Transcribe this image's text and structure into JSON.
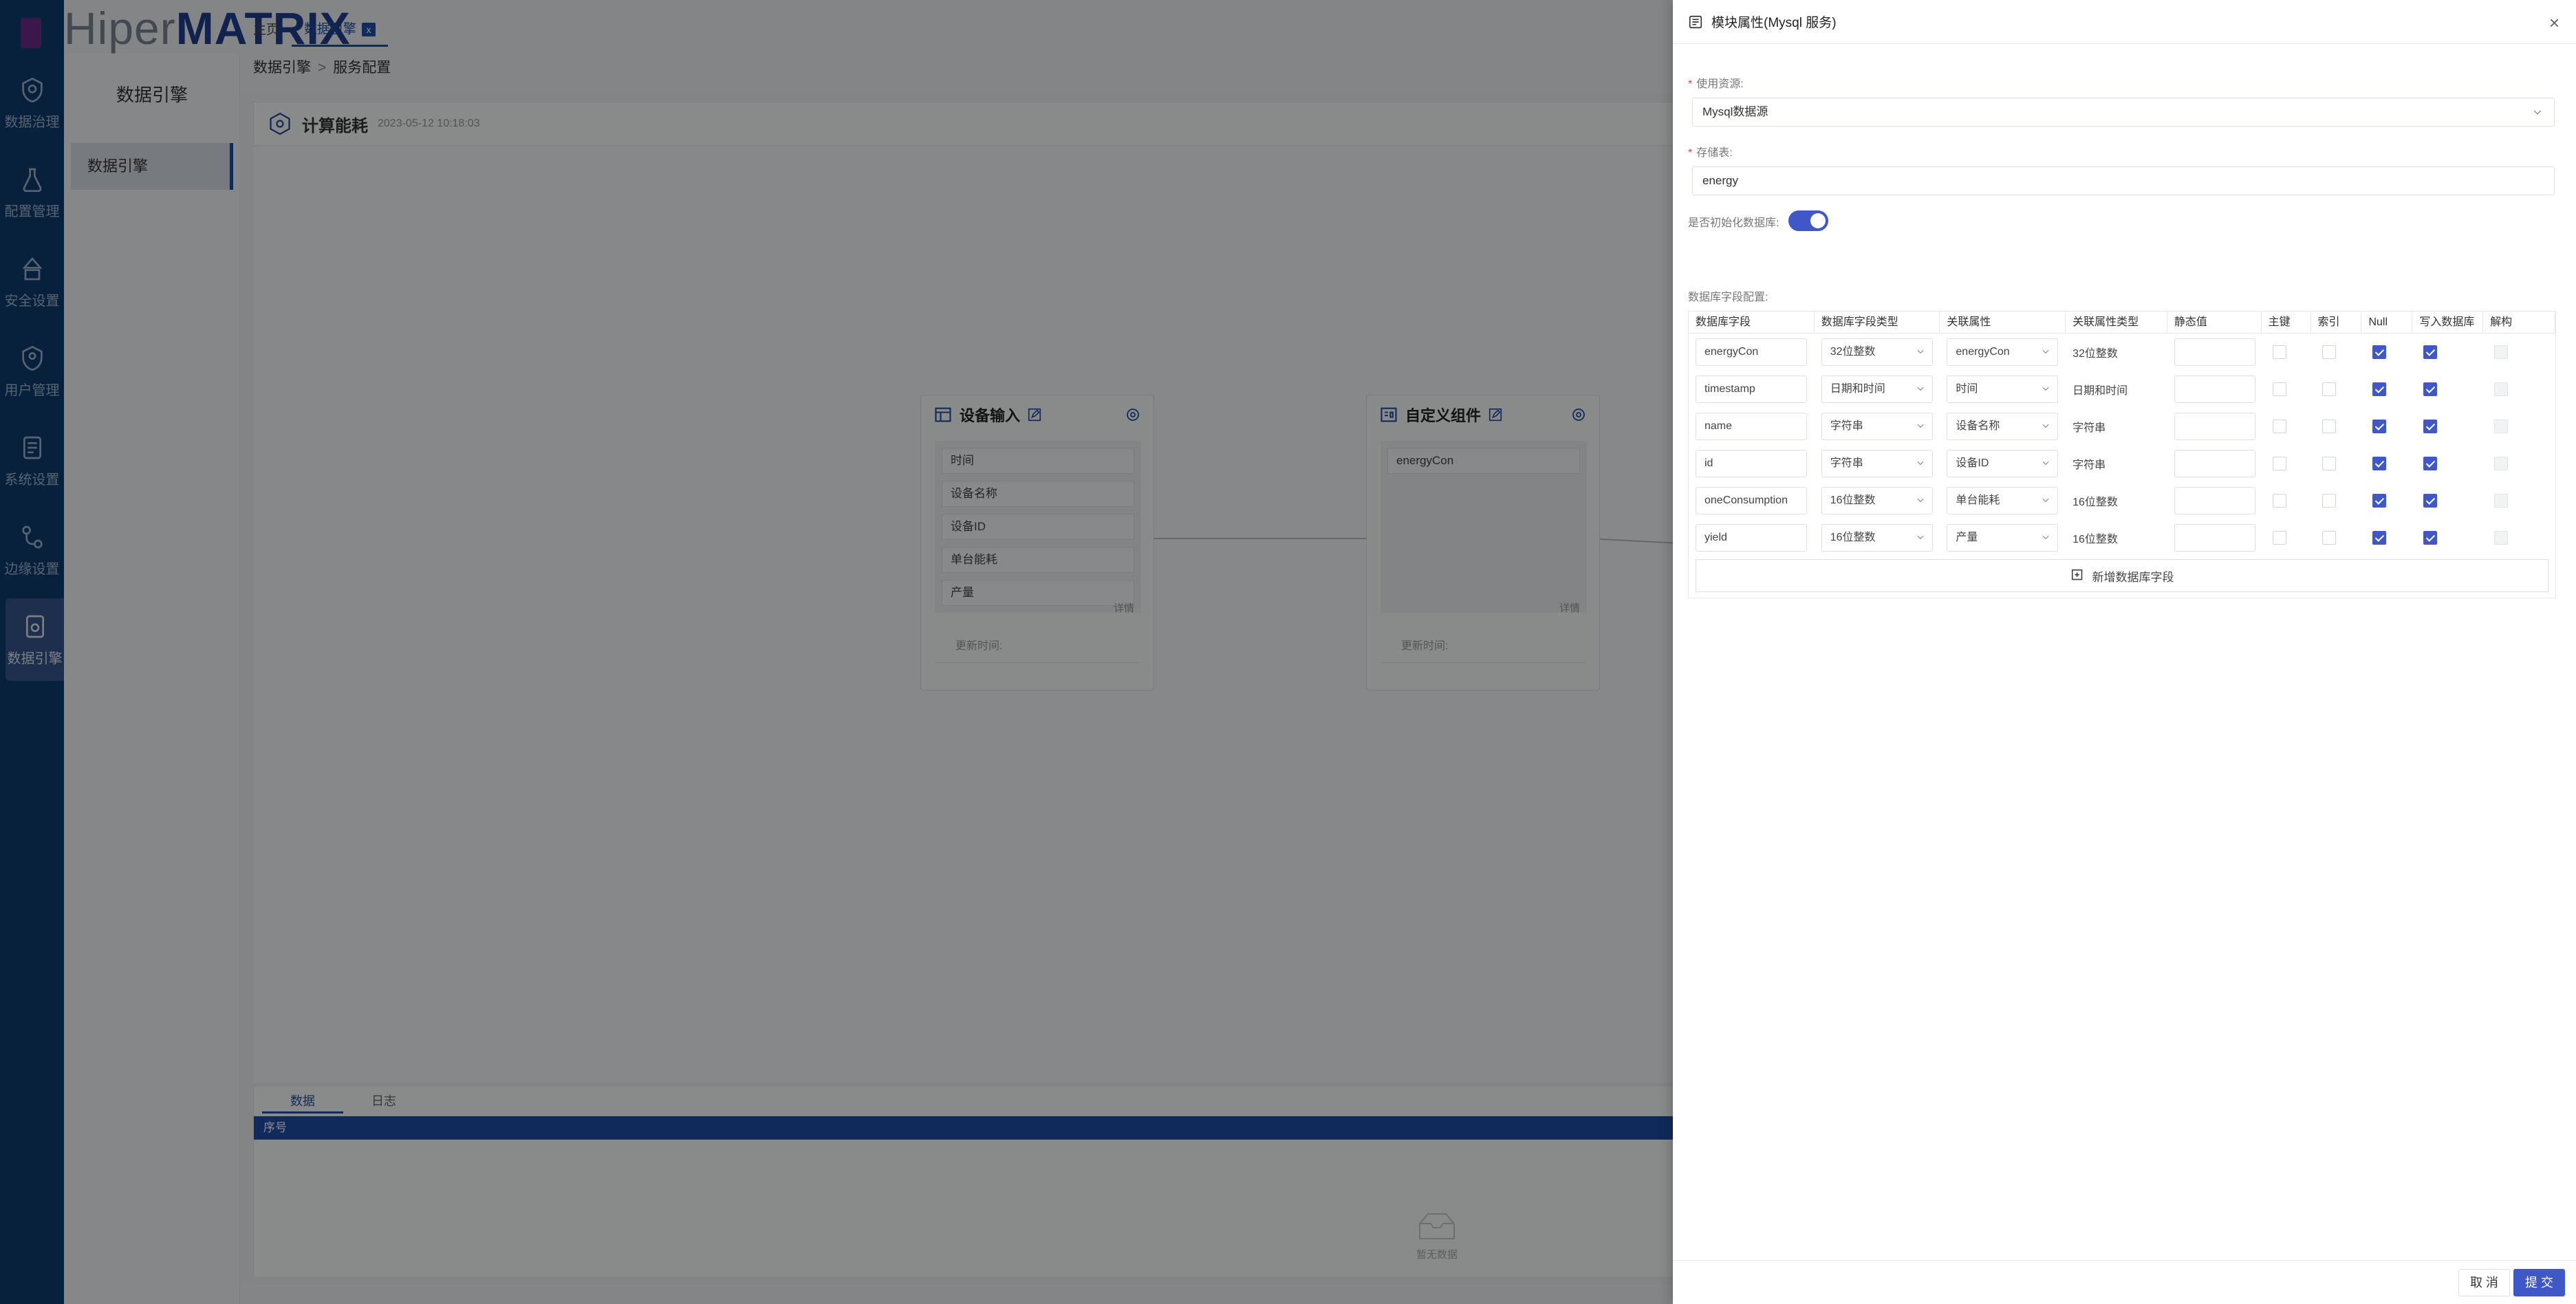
{
  "brand": {
    "part1": "Hiper",
    "part2": "MATRIX"
  },
  "sidebar": {
    "items": [
      {
        "label": "数据治理",
        "icon": "shield-hex-icon"
      },
      {
        "label": "配置管理",
        "icon": "flask-icon"
      },
      {
        "label": "安全设置",
        "icon": "security-icon"
      },
      {
        "label": "用户管理",
        "icon": "user-shield-icon"
      },
      {
        "label": "系统设置",
        "icon": "settings-doc-icon"
      },
      {
        "label": "边缘设置",
        "icon": "edge-icon"
      },
      {
        "label": "数据引擎",
        "icon": "engine-icon"
      }
    ]
  },
  "submenu": {
    "title": "数据引擎",
    "item": "数据引擎"
  },
  "tabs": {
    "home": "主页",
    "active": "数据引擎",
    "close": "x"
  },
  "breadcrumb": {
    "parent": "数据引擎",
    "separator": ">",
    "current": "服务配置"
  },
  "workspace": {
    "title": "计算能耗",
    "time": "2023-05-12 10:18:03",
    "nodes": [
      {
        "title": "设备输入",
        "fields": [
          "时间",
          "设备名称",
          "设备ID",
          "单台能耗",
          "产量"
        ],
        "detail": "详情",
        "update": "更新时间:"
      },
      {
        "title": "自定义组件",
        "fields": [
          "energyCon"
        ],
        "detail": "详情",
        "update": "更新时间:"
      }
    ],
    "bottom": {
      "tabs": [
        "数据",
        "日志"
      ],
      "header": "序号",
      "empty": "暂无数据"
    }
  },
  "drawer": {
    "title": "模块属性(Mysql 服务)",
    "close": "×",
    "resource_label": "使用资源:",
    "resource_value": "Mysql数据源",
    "table_label": "存储表:",
    "table_value": "energy",
    "init_label": "是否初始化数据库:",
    "init_value": true,
    "fields_label": "数据库字段配置:",
    "columns": [
      "数据库字段",
      "数据库字段类型",
      "关联属性",
      "关联属性类型",
      "静态值",
      "主键",
      "索引",
      "Null",
      "写入数据库",
      "解构"
    ],
    "rows": [
      {
        "field": "energyCon",
        "type": "32位整数",
        "attr": "energyCon",
        "attr_type": "32位整数",
        "static": "",
        "pk": false,
        "index": false,
        "null": true,
        "write": true,
        "destruct": false
      },
      {
        "field": "timestamp",
        "type": "日期和时间",
        "attr": "时间",
        "attr_type": "日期和时间",
        "static": "",
        "pk": false,
        "index": false,
        "null": true,
        "write": true,
        "destruct": false
      },
      {
        "field": "name",
        "type": "字符串",
        "attr": "设备名称",
        "attr_type": "字符串",
        "static": "",
        "pk": false,
        "index": false,
        "null": true,
        "write": true,
        "destruct": false
      },
      {
        "field": "id",
        "type": "字符串",
        "attr": "设备ID",
        "attr_type": "字符串",
        "static": "",
        "pk": false,
        "index": false,
        "null": true,
        "write": true,
        "destruct": false
      },
      {
        "field": "oneConsumption",
        "type": "16位整数",
        "attr": "单台能耗",
        "attr_type": "16位整数",
        "static": "",
        "pk": false,
        "index": false,
        "null": true,
        "write": true,
        "destruct": false
      },
      {
        "field": "yield",
        "type": "16位整数",
        "attr": "产量",
        "attr_type": "16位整数",
        "static": "",
        "pk": false,
        "index": false,
        "null": true,
        "write": true,
        "destruct": false
      }
    ],
    "add_field": "新增数据库字段",
    "cancel": "取 消",
    "submit": "提 交"
  },
  "colors": {
    "primary": "#4058c7",
    "sidebar": "#0e3c6e",
    "brand": "#1e3e8c"
  }
}
